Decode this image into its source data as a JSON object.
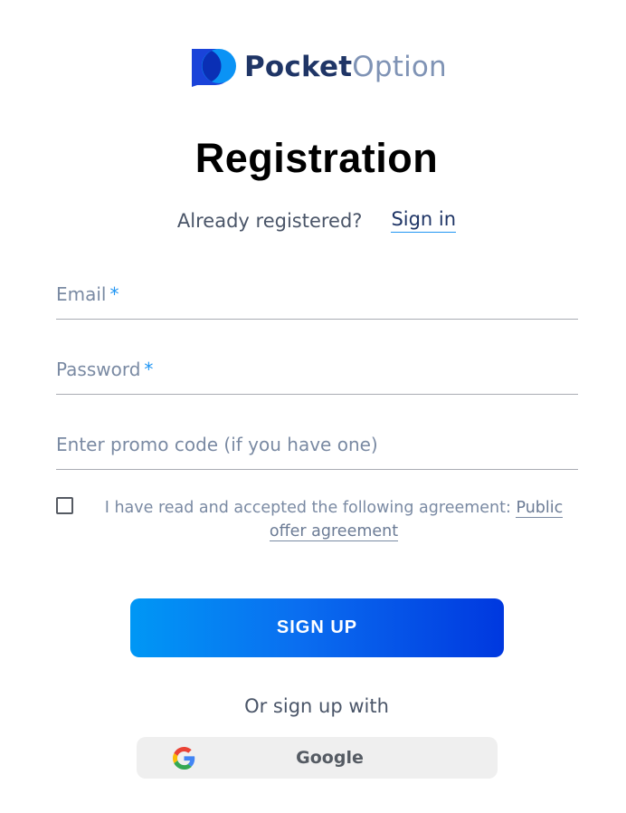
{
  "brand": {
    "part1": "Pocket",
    "part2": "Option"
  },
  "page": {
    "title": "Registration"
  },
  "signin_prompt": {
    "text": "Already registered?",
    "link": "Sign in"
  },
  "form": {
    "email": {
      "label": "Email",
      "required_mark": "*",
      "value": ""
    },
    "password": {
      "label": "Password",
      "required_mark": "*",
      "value": ""
    },
    "promo": {
      "placeholder": "Enter promo code (if you have one)",
      "value": ""
    }
  },
  "agreement": {
    "checked": false,
    "text": "I have read and accepted the following agreement: ",
    "link": "Public offer agreement"
  },
  "signup_button": {
    "label": "SIGN UP"
  },
  "alt_signup": {
    "text": "Or sign up with",
    "google_label": "Google"
  },
  "colors": {
    "accent": "#2196f3",
    "brand_dark": "#1f3566",
    "brand_light": "#7f93b5",
    "button_gradient_start": "#0097f5",
    "button_gradient_end": "#0038df"
  },
  "icons": {
    "brand": "pocket-option-logo-icon",
    "google": "google-icon"
  }
}
